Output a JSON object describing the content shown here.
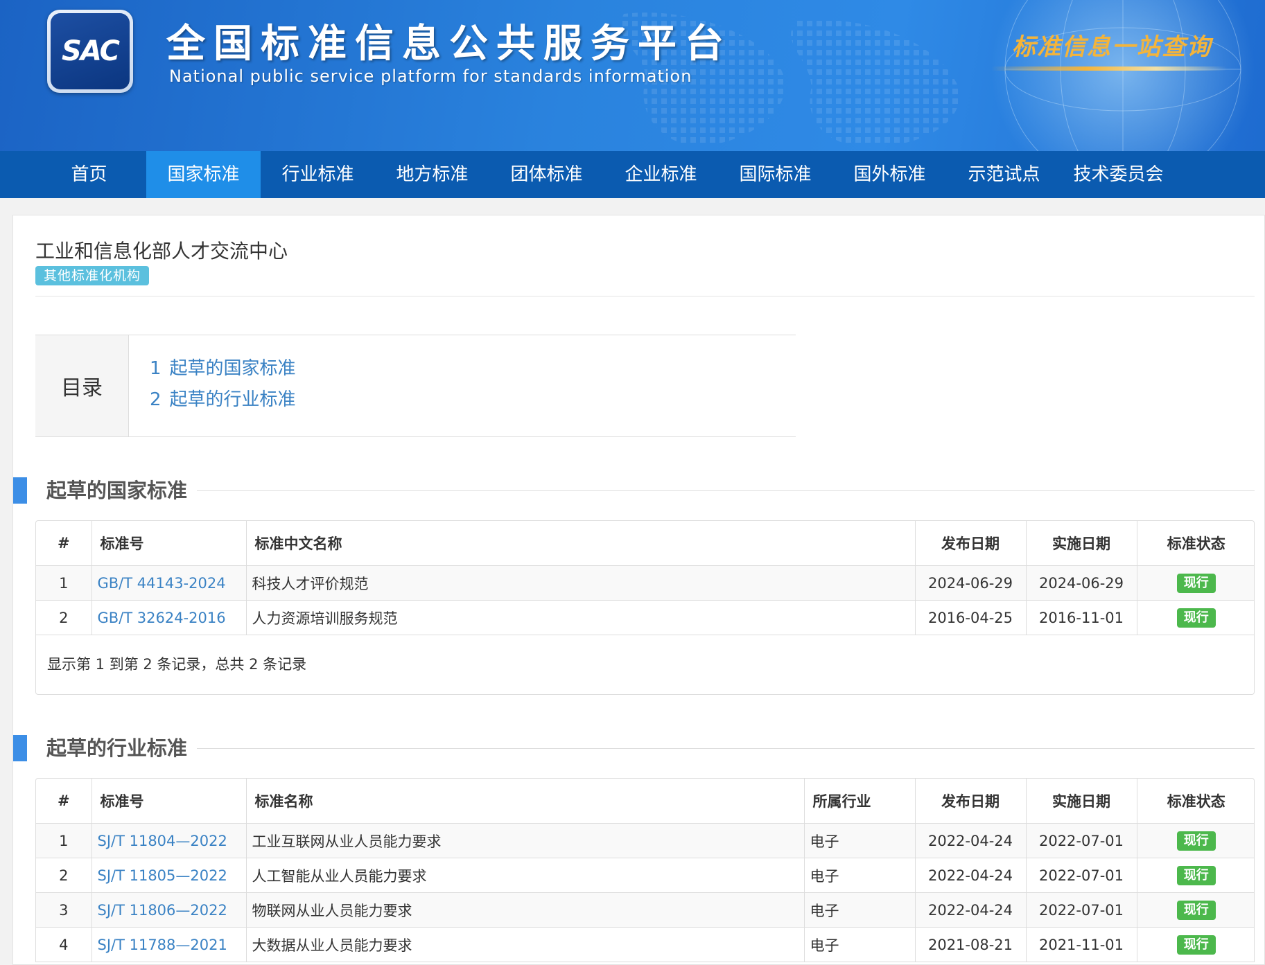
{
  "header": {
    "logo_text": "SAC",
    "title": "全国标准信息公共服务平台",
    "subtitle": "National public service platform  for standards information",
    "slogan": "标准信息一站查询"
  },
  "nav": [
    {
      "label": "首页"
    },
    {
      "label": "国家标准",
      "active": true
    },
    {
      "label": "行业标准"
    },
    {
      "label": "地方标准"
    },
    {
      "label": "团体标准"
    },
    {
      "label": "企业标准"
    },
    {
      "label": "国际标准"
    },
    {
      "label": "国外标准"
    },
    {
      "label": "示范试点"
    },
    {
      "label": "技术委员会"
    }
  ],
  "org": {
    "name": "工业和信息化部人才交流中心",
    "tag": "其他标准化机构"
  },
  "toc": {
    "label": "目录",
    "items": [
      {
        "num": "1",
        "label": "起草的国家标准"
      },
      {
        "num": "2",
        "label": "起草的行业标准"
      }
    ]
  },
  "national": {
    "title": "起草的国家标准",
    "headers": [
      "#",
      "标准号",
      "标准中文名称",
      "发布日期",
      "实施日期",
      "标准状态"
    ],
    "rows": [
      {
        "idx": "1",
        "code": "GB/T 44143-2024",
        "name": "科技人才评价规范",
        "pub": "2024-06-29",
        "impl": "2024-06-29",
        "status": "现行"
      },
      {
        "idx": "2",
        "code": "GB/T 32624-2016",
        "name": "人力资源培训服务规范",
        "pub": "2016-04-25",
        "impl": "2016-11-01",
        "status": "现行"
      }
    ],
    "footer": "显示第 1 到第 2 条记录，总共 2 条记录"
  },
  "industry": {
    "title": "起草的行业标准",
    "headers": [
      "#",
      "标准号",
      "标准名称",
      "所属行业",
      "发布日期",
      "实施日期",
      "标准状态"
    ],
    "rows": [
      {
        "idx": "1",
        "code": "SJ/T 11804—2022",
        "name": "工业互联网从业人员能力要求",
        "sector": "电子",
        "pub": "2022-04-24",
        "impl": "2022-07-01",
        "status": "现行"
      },
      {
        "idx": "2",
        "code": "SJ/T 11805—2022",
        "name": "人工智能从业人员能力要求",
        "sector": "电子",
        "pub": "2022-04-24",
        "impl": "2022-07-01",
        "status": "现行"
      },
      {
        "idx": "3",
        "code": "SJ/T 11806—2022",
        "name": "物联网从业人员能力要求",
        "sector": "电子",
        "pub": "2022-04-24",
        "impl": "2022-07-01",
        "status": "现行"
      },
      {
        "idx": "4",
        "code": "SJ/T 11788—2021",
        "name": "大数据从业人员能力要求",
        "sector": "电子",
        "pub": "2021-08-21",
        "impl": "2021-11-01",
        "status": "现行"
      }
    ]
  }
}
